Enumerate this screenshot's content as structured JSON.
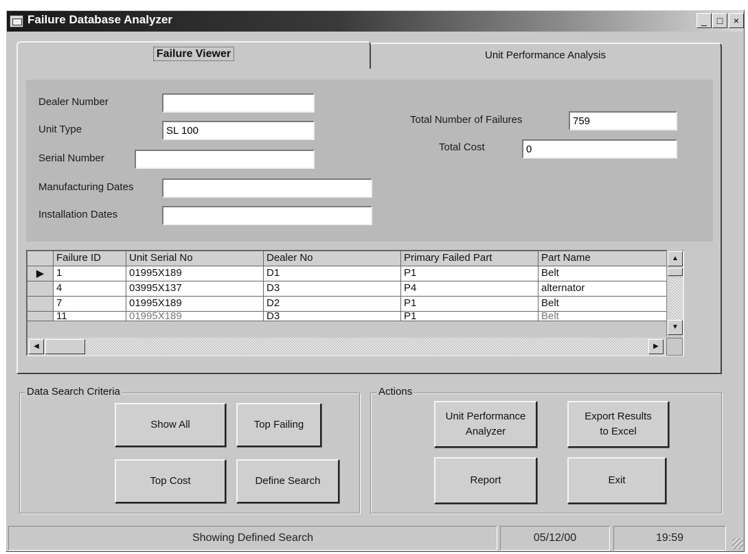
{
  "window": {
    "title": "Failure Database Analyzer",
    "controls": [
      "_",
      "□",
      "×"
    ]
  },
  "tabs": [
    {
      "label": "Failure Viewer",
      "active": true
    },
    {
      "label": "Unit Performance Analysis",
      "active": false
    }
  ],
  "form": {
    "dealer_number": {
      "label": "Dealer Number",
      "value": ""
    },
    "unit_type": {
      "label": "Unit Type",
      "value": "SL 100"
    },
    "serial_number": {
      "label": "Serial Number",
      "value": ""
    },
    "manufacturing_dates": {
      "label": "Manufacturing Dates",
      "value": ""
    },
    "installation_dates": {
      "label": "Installation Dates",
      "value": ""
    },
    "total_failures": {
      "label": "Total Number of Failures",
      "value": "759"
    },
    "total_cost": {
      "label": "Total Cost",
      "value": "0"
    }
  },
  "grid": {
    "columns": [
      "Failure ID",
      "Unit Serial No",
      "Dealer No",
      "Primary Failed Part",
      "Part Name"
    ],
    "rows": [
      [
        "1",
        "01995X189",
        "D1",
        "P1",
        "Belt"
      ],
      [
        "4",
        "03995X137",
        "D3",
        "P4",
        "alternator"
      ],
      [
        "7",
        "01995X189",
        "D2",
        "P1",
        "Belt"
      ],
      [
        "11",
        "01995X189",
        "D3",
        "P1",
        "Belt"
      ]
    ],
    "row_indicator": "▶"
  },
  "search_group": {
    "title": "Data Search Criteria",
    "buttons": {
      "show_all": "Show All",
      "top_failing": "Top Failing",
      "top_cost": "Top Cost",
      "define_search": "Define Search"
    }
  },
  "actions_group": {
    "title": "Actions",
    "buttons": {
      "unit_performance": "Unit Performance\nAnalyzer",
      "export": "Export Results\nto Excel",
      "report": "Report",
      "exit": "Exit"
    }
  },
  "status": {
    "message": "Showing Defined Search",
    "date": "05/12/00",
    "time": "19:59"
  }
}
